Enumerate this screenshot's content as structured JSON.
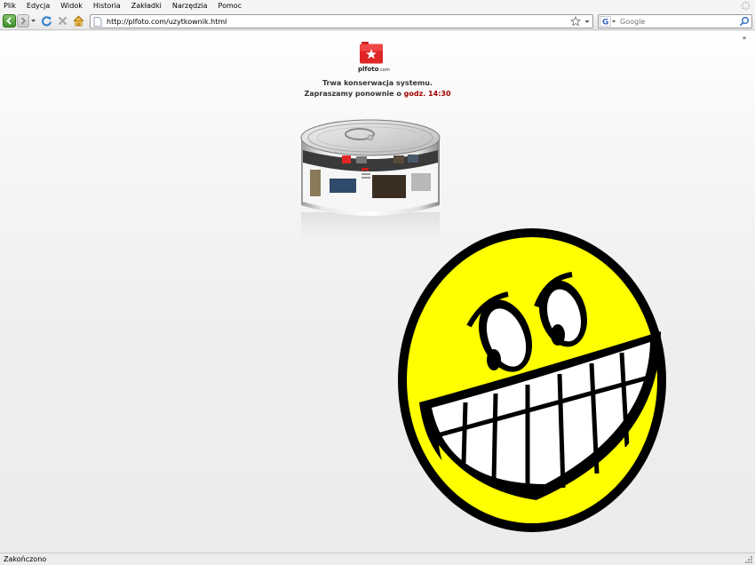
{
  "menu": [
    "Plik",
    "Edycja",
    "Widok",
    "Historia",
    "Zakładki",
    "Narzędzia",
    "Pomoc"
  ],
  "toolbar": {
    "url": "http://plfoto.com/uzytkownik.html",
    "search_placeholder": "Google",
    "search_engine": "Google",
    "back_color": "#3f8e2a"
  },
  "page": {
    "logo_text": "plfoto",
    "logo_suffix": ".com",
    "message_line1": "Trwa konserwacja systemu.",
    "message_line2_prefix": "Zapraszamy ponownie o ",
    "message_time": "godz. 14:30",
    "accent_color": "#a50000"
  },
  "statusbar": {
    "text": "Zakończono"
  }
}
